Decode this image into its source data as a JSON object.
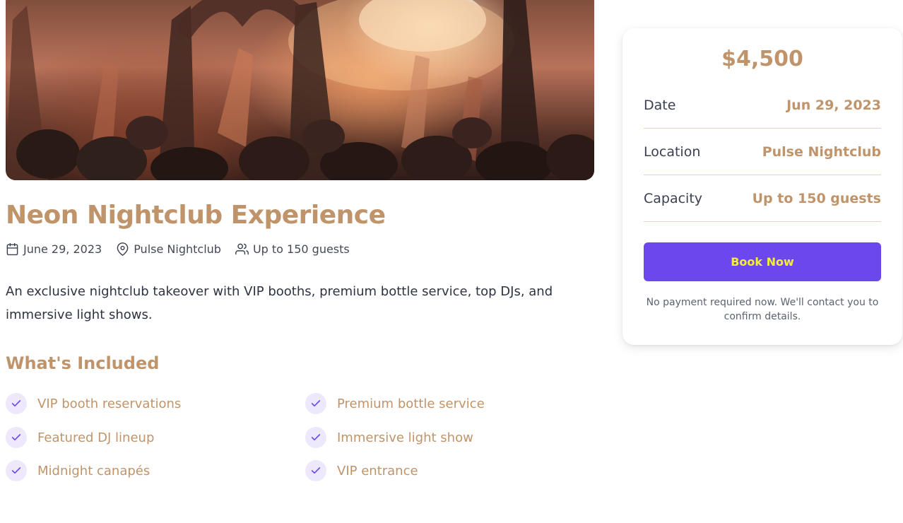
{
  "event": {
    "title": "Neon Nightclub Experience",
    "meta": {
      "date": "June 29, 2023",
      "location": "Pulse Nightclub",
      "capacity": "Up to 150 guests"
    },
    "description": "An exclusive nightclub takeover with VIP booths, premium bottle service, top DJs, and immersive light shows."
  },
  "included": {
    "title": "What's Included",
    "items": [
      "VIP booth reservations",
      "Premium bottle service",
      "Featured DJ lineup",
      "Immersive light show",
      "Midnight canapés",
      "VIP entrance"
    ]
  },
  "booking": {
    "price": "$4,500",
    "rows": [
      {
        "label": "Date",
        "value": "Jun 29, 2023"
      },
      {
        "label": "Location",
        "value": "Pulse Nightclub"
      },
      {
        "label": "Capacity",
        "value": "Up to 150 guests"
      }
    ],
    "button_label": "Book Now",
    "note": "No payment required now. We'll contact you to confirm details."
  },
  "colors": {
    "accent_gold": "#c0946a",
    "button_purple": "#6c47ee",
    "button_text_yellow": "#f5ed3a",
    "divider_yellow": "#f2e84c",
    "check_bg": "#ede8fb"
  },
  "icons": {
    "meta_date": "calendar-icon",
    "meta_location": "map-pin-icon",
    "meta_capacity": "users-icon",
    "feature_check": "check-icon"
  }
}
